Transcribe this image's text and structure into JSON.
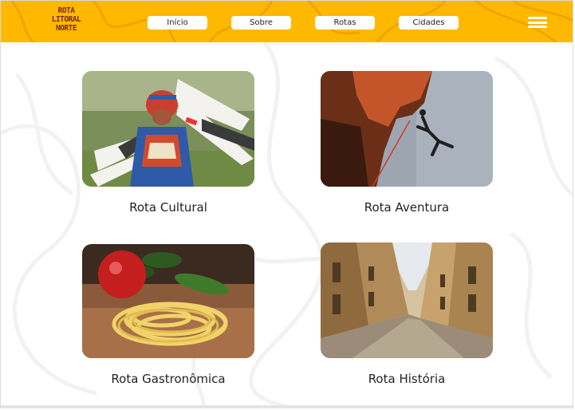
{
  "header": {
    "logo": {
      "line1": "ROTA",
      "line2": "LITORAL",
      "line3": "NORTE"
    },
    "nav": [
      {
        "label": "Início"
      },
      {
        "label": "Sobre"
      },
      {
        "label": "Rotas"
      },
      {
        "label": "Cidades"
      }
    ],
    "menu_icon": "hamburger-icon"
  },
  "routes": [
    {
      "title": "Rota Cultural"
    },
    {
      "title": "Rota Aventura"
    },
    {
      "title": "Rota Gastronômica"
    },
    {
      "title": "Rota História"
    }
  ],
  "colors": {
    "header_bg": "#ffb800",
    "logo": "#7a2a14",
    "text": "#222222",
    "background": "#ffffff"
  }
}
